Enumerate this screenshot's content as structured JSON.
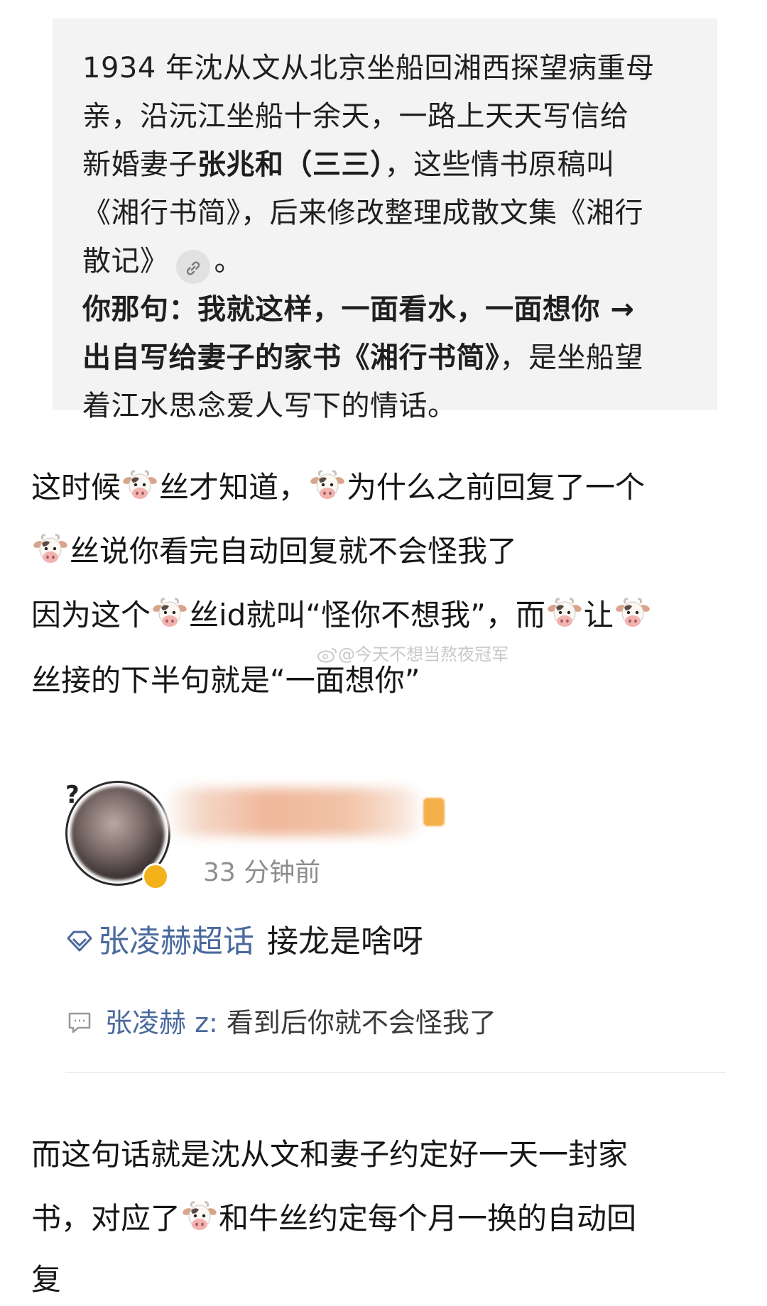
{
  "quote": {
    "lines": [
      "1934 年沈从文从北京坐船回湘西探望病重母",
      "亲，沿沅江坐船十余天，一路上天天写信给",
      "《湘行书简》，后来修改整理成散文集《湘行",
      "着江水思念爱人写下的情话。"
    ],
    "line3_pre": "新婚妻子",
    "line3_bold": "张兆和（三三）",
    "line3_post": "，这些情书原稿叫",
    "line5_text": "散记》",
    "line5_end": "。",
    "line6_bold": "你那句：我就这样，一面看水，一面想你 →",
    "line7_bold": "出自写给妻子的家书《湘行书简》",
    "line7_post": "，是坐船望"
  },
  "paragraph1": {
    "l1_a": "这时候",
    "l1_b": "丝才知道，",
    "l1_c": "为什么之前回复了一个",
    "l2": "丝说你看完自动回复就不会怪我了",
    "l3_a": "因为这个",
    "l3_b": "丝id就叫“怪你不想我”，而",
    "l3_c": "让",
    "l4": "丝接的下半句就是“一面想你”"
  },
  "watermark": "@今天不想当熬夜冠军",
  "comment": {
    "timestamp": "33 分钟前",
    "topic": "张凌赫超话",
    "text": "接龙是啥呀",
    "reply_user": "张凌赫 z:",
    "reply_text": " 看到后你就不会怪我了"
  },
  "paragraph2": {
    "l1": "而这句话就是沈从文和妻子约定好一天一封家",
    "l2_a": "书，对应了",
    "l2_b": "和牛丝约定每个月一换的自动回",
    "l3": "复"
  },
  "icons": {
    "cow": "cow-face-emoji",
    "link": "link-icon",
    "topic": "diamond-topic-icon",
    "reply": "comment-bubble-icon",
    "weibo": "weibo-logo-icon"
  },
  "colors": {
    "link_blue": "#4a6a9e",
    "quote_bg": "#f3f3f3",
    "verified": "#f3b21a"
  }
}
